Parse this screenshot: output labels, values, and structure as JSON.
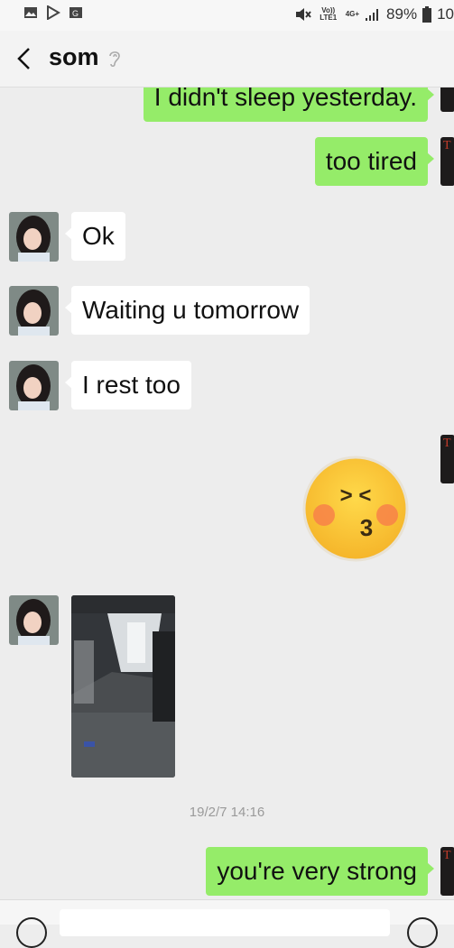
{
  "status_bar": {
    "volte": "Vo)) LTE1",
    "network": "4G+",
    "battery": "89%",
    "time": "10"
  },
  "header": {
    "back_icon": "chevron-left-icon",
    "contact_name": "som",
    "earpiece_icon": "ear-icon"
  },
  "messages": [
    {
      "side": "right",
      "text": "I didn't sleep yesterday."
    },
    {
      "side": "right",
      "text": "too tired"
    },
    {
      "side": "left",
      "text": "Ok"
    },
    {
      "side": "left",
      "text": "Waiting u tomorrow"
    },
    {
      "side": "left",
      "text": "I rest too"
    },
    {
      "side": "right",
      "type": "sticker",
      "icon": "kiss-face-emoji-icon",
      "glyph_eyes": "> <",
      "glyph_mouth": "3"
    },
    {
      "side": "left",
      "type": "image",
      "icon": "photo-thumbnail"
    },
    {
      "side": "right",
      "text": "you're very strong"
    }
  ],
  "timestamp": "19/2/7 14:16",
  "colors": {
    "sent_bubble": "#95ec69",
    "received_bubble": "#ffffff",
    "background": "#ededed"
  }
}
